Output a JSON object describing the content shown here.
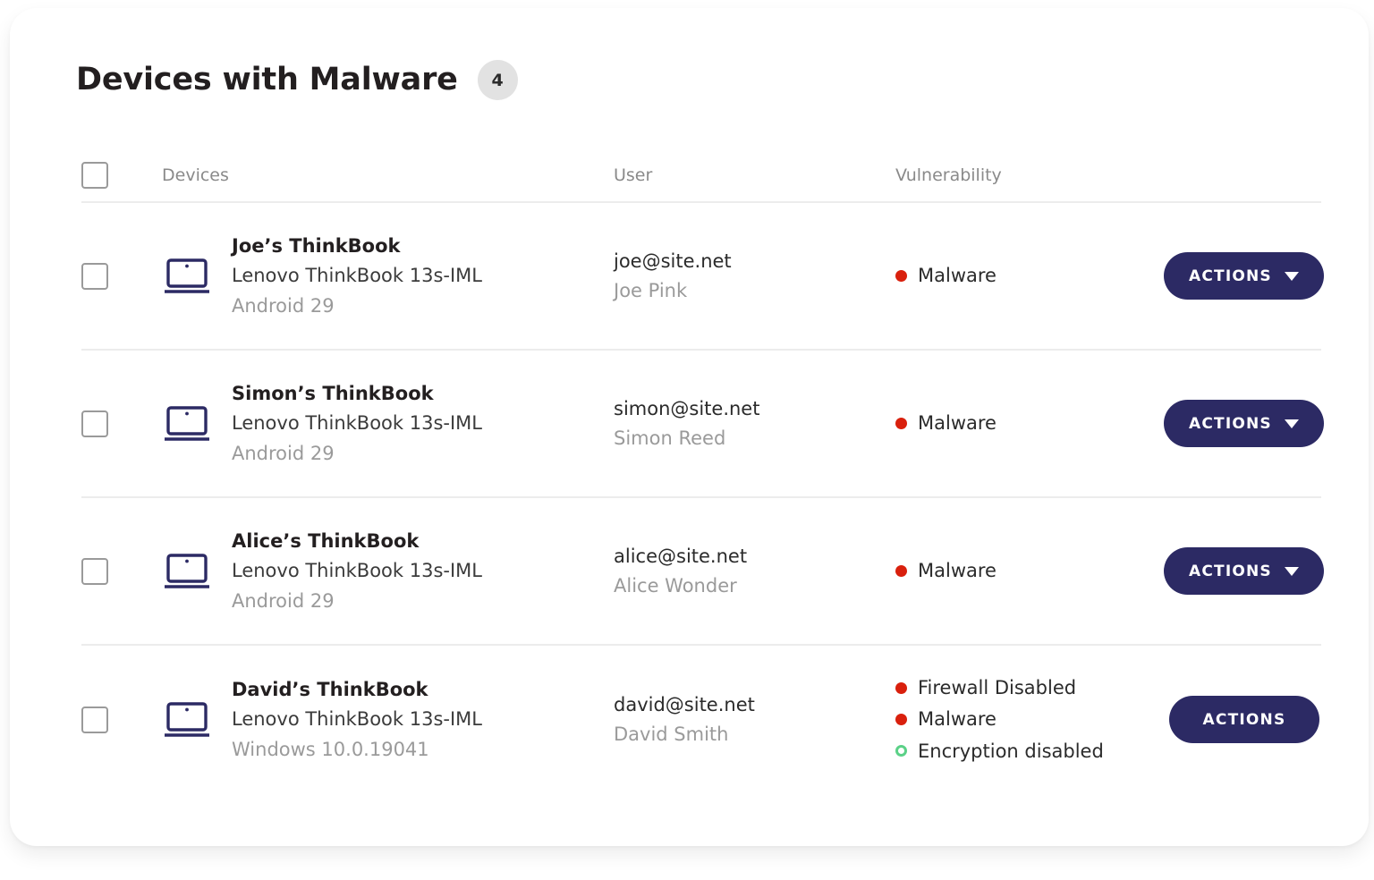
{
  "card": {
    "title": "Devices with Malware",
    "count_badge": "4"
  },
  "table": {
    "headers": {
      "select_all": "",
      "devices": "Devices",
      "user": "User",
      "vulnerability": "Vulnerability"
    },
    "rows": [
      {
        "device_icon": "laptop-icon",
        "device_name": "Joe’s ThinkBook",
        "device_model": "Lenovo ThinkBook 13s-IML",
        "device_os": "Android 29",
        "user_email": "joe@site.net",
        "user_name": "Joe Pink",
        "vulnerabilities": [
          {
            "label": "Malware",
            "marker": "red-dot"
          }
        ],
        "action_label": "ACTIONS",
        "has_caret": true
      },
      {
        "device_icon": "laptop-icon",
        "device_name": "Simon’s ThinkBook",
        "device_model": "Lenovo ThinkBook 13s-IML",
        "device_os": "Android 29",
        "user_email": "simon@site.net",
        "user_name": "Simon Reed",
        "vulnerabilities": [
          {
            "label": "Malware",
            "marker": "red-dot"
          }
        ],
        "action_label": "ACTIONS",
        "has_caret": true
      },
      {
        "device_icon": "laptop-icon",
        "device_name": "Alice’s ThinkBook",
        "device_model": "Lenovo ThinkBook 13s-IML",
        "device_os": "Android 29",
        "user_email": "alice@site.net",
        "user_name": "Alice Wonder",
        "vulnerabilities": [
          {
            "label": "Malware",
            "marker": "red-dot"
          }
        ],
        "action_label": "ACTIONS",
        "has_caret": true
      },
      {
        "device_icon": "laptop-icon",
        "device_name": "David’s ThinkBook",
        "device_model": "Lenovo ThinkBook 13s-IML",
        "device_os": "Windows 10.0.19041",
        "user_email": "david@site.net",
        "user_name": "David Smith",
        "vulnerabilities": [
          {
            "label": "Firewall Disabled",
            "marker": "red-dot"
          },
          {
            "label": "Malware",
            "marker": "red-dot"
          },
          {
            "label": "Encryption disabled",
            "marker": "green-ring"
          }
        ],
        "action_label": "ACTIONS",
        "has_caret": false
      }
    ]
  },
  "colors": {
    "accent_navy": "#2c2a64",
    "alert_red": "#d9200d",
    "ok_green": "#5bd187",
    "badge_gray": "#e2e2e2",
    "divider": "#ececec",
    "muted_text": "#9a9a9a"
  }
}
